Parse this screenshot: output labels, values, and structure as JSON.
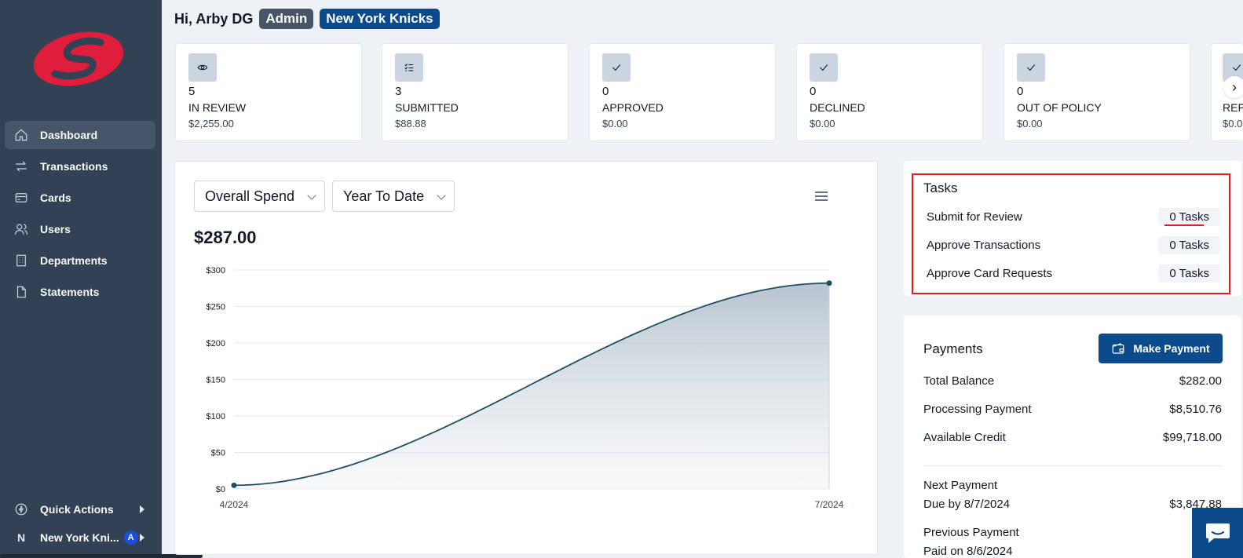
{
  "brand": {
    "accent": "#0b4a8b",
    "logo_color": "#e11d3c"
  },
  "sidebar": {
    "items": [
      {
        "label": "Dashboard",
        "icon": "home-icon",
        "active": true
      },
      {
        "label": "Transactions",
        "icon": "transfer-icon"
      },
      {
        "label": "Cards",
        "icon": "card-icon"
      },
      {
        "label": "Users",
        "icon": "users-icon"
      },
      {
        "label": "Departments",
        "icon": "building-icon"
      },
      {
        "label": "Statements",
        "icon": "document-icon"
      }
    ],
    "quick_actions": "Quick Actions",
    "org_initial": "N",
    "org_name": "New York Kni...",
    "org_badge": "A"
  },
  "header": {
    "greeting": "Hi, Arby DG",
    "role_badge": "Admin",
    "team_badge": "New York Knicks"
  },
  "stats": [
    {
      "count": "5",
      "label": "IN REVIEW",
      "amount": "$2,255.00",
      "icon": "eye-icon"
    },
    {
      "count": "3",
      "label": "SUBMITTED",
      "amount": "$88.88",
      "icon": "checklist-icon"
    },
    {
      "count": "0",
      "label": "APPROVED",
      "amount": "$0.00",
      "icon": "check-icon"
    },
    {
      "count": "0",
      "label": "DECLINED",
      "amount": "$0.00",
      "icon": "check-icon"
    },
    {
      "count": "0",
      "label": "OUT OF POLICY",
      "amount": "$0.00",
      "icon": "check-icon"
    },
    {
      "count": "",
      "label": "REF",
      "amount": "$0.0",
      "icon": "check-icon"
    }
  ],
  "spend": {
    "metric_select": "Overall Spend",
    "period_select": "Year To Date",
    "total": "$287.00"
  },
  "chart_data": {
    "type": "area",
    "x": [
      "4/2024",
      "7/2024"
    ],
    "values": [
      5,
      282
    ],
    "y_ticks": [
      "$300",
      "$250",
      "$200",
      "$150",
      "$100",
      "$50",
      "$0"
    ],
    "ylim": [
      0,
      300
    ],
    "grid": true,
    "line_color": "#1e4e66"
  },
  "tasks": {
    "title": "Tasks",
    "rows": [
      {
        "label": "Submit for Review",
        "count": "0 Tasks"
      },
      {
        "label": "Approve Transactions",
        "count": "0 Tasks"
      },
      {
        "label": "Approve Card Requests",
        "count": "0 Tasks"
      }
    ]
  },
  "payments": {
    "title": "Payments",
    "make_payment": "Make Payment",
    "rows": [
      {
        "label": "Total Balance",
        "value": "$282.00"
      },
      {
        "label": "Processing Payment",
        "value": "$8,510.76"
      },
      {
        "label": "Available Credit",
        "value": "$99,718.00"
      }
    ],
    "next_payment_label": "Next Payment",
    "next_payment_due": "Due by 8/7/2024",
    "next_payment_amount": "$3,847.88",
    "previous_payment_label": "Previous Payment",
    "previous_payment_date": "Paid on 8/6/2024"
  }
}
